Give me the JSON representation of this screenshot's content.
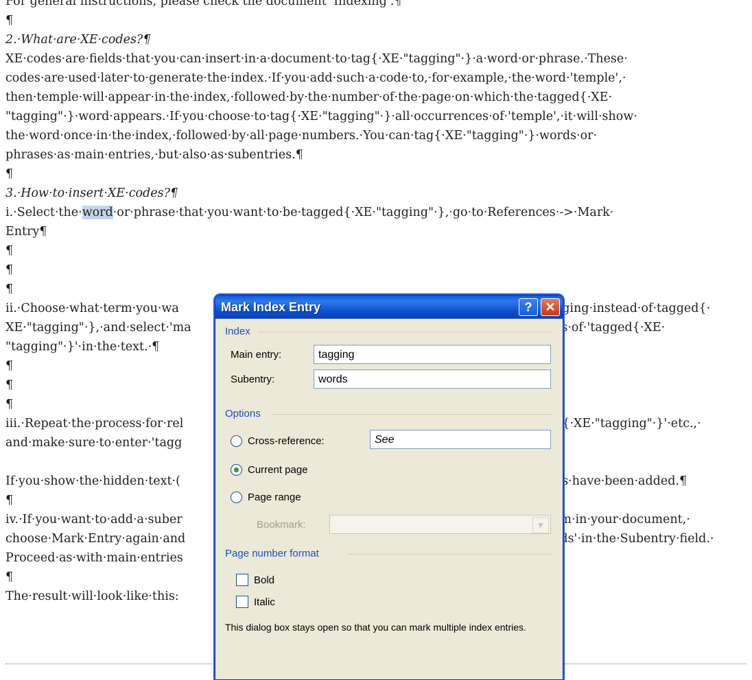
{
  "document": {
    "lines": [
      {
        "text": "For general instructions, please check the document 'Indexing'.¶",
        "style": "normal"
      },
      {
        "text": "¶",
        "style": "normal"
      },
      {
        "text": "2.·What·are·XE·codes?¶",
        "style": "italic"
      },
      {
        "text": "XE·codes·are·fields·that·you·can·insert·in·a·document·to·tag{·XE·\"tagging\"·}·a·word·or·phrase.·These·",
        "style": "normal"
      },
      {
        "text": "codes·are·used·later·to·generate·the·index.·If·you·add·such·a·code·to,·for·example,·the·word·'temple',·",
        "style": "normal"
      },
      {
        "text": "then·temple·will·appear·in·the·index,·followed·by·the·number·of·the·page·on·which·the·tagged{·XE·",
        "style": "normal"
      },
      {
        "text": "\"tagging\"·}·word·appears.·If·you·choose·to·tag{·XE·\"tagging\"·}·all·occurrences·of·'temple',·it·will·show·",
        "style": "normal"
      },
      {
        "text": "the·word·once·in·the·index,·followed·by·all·page·numbers.·You·can·tag{·XE·\"tagging\"·}·words·or·",
        "style": "normal"
      },
      {
        "text": "phrases·as·main·entries,·but·also·as·subentries.¶",
        "style": "normal"
      },
      {
        "text": "¶",
        "style": "normal"
      },
      {
        "text": "3.·How·to·insert·XE·codes?¶",
        "style": "italic"
      },
      {
        "text": "i.·Select·the·",
        "selected": "word",
        "rest": "·or·phrase·that·you·want·to·be·tagged{·XE·\"tagging\"·},·go·to·References·->·Mark·",
        "style": "select"
      },
      {
        "text": "Entry¶",
        "style": "normal"
      },
      {
        "text": "¶",
        "style": "normal"
      },
      {
        "text": "¶",
        "style": "normal"
      },
      {
        "text": "¶",
        "style": "normal"
      },
      {
        "text": "ii.·Choose·what·term·you·wa",
        "right": "gging·instead·of·tagged{·",
        "style": "split"
      },
      {
        "text": "XE·\"tagging\"·},·and·select·'ma",
        "right": "es·of·'tagged{·XE·",
        "style": "split"
      },
      {
        "text": "\"tagging\"·}'·in·the·text.·¶",
        "style": "normal"
      },
      {
        "text": "¶",
        "style": "normal"
      },
      {
        "text": "¶",
        "style": "normal"
      },
      {
        "text": "¶",
        "style": "normal"
      },
      {
        "text": "iii.·Repeat·the·process·for·rel",
        "right": "g{·XE·\"tagging\"·}'·etc.,·",
        "style": "split"
      },
      {
        "text": "and·make·sure·to·enter·'tagg",
        "style": "normal"
      },
      {
        "text": "",
        "style": "normal"
      },
      {
        "text": "If·you·show·the·hidden·text·(",
        "right": "ds·have·been·added.¶",
        "style": "split"
      },
      {
        "text": "¶",
        "style": "normal"
      },
      {
        "text": "iv.·If·you·want·to·add·a·suber",
        "right": "rm·in·your·document,·",
        "style": "split"
      },
      {
        "text": "choose·Mark·Entry·again·and",
        "right": "rds'·in·the·Subentry·field.·",
        "style": "split"
      },
      {
        "text": "Proceed·as·with·main·entries",
        "style": "normal"
      },
      {
        "text": "¶",
        "style": "normal"
      },
      {
        "text": "The·result·will·look·like·this:",
        "style": "normal"
      }
    ]
  },
  "dialog": {
    "title": "Mark Index Entry",
    "help_glyph": "?",
    "close_glyph": "✕",
    "index_group": "Index",
    "main_entry_label": "Main entry:",
    "main_entry_value": "tagging",
    "subentry_label": "Subentry:",
    "subentry_value": "words",
    "options_group": "Options",
    "cross_reference_label": "Cross-reference:",
    "cross_reference_value": "See",
    "current_page_label": "Current page",
    "page_range_label": "Page range",
    "bookmark_label": "Bookmark:",
    "page_number_format_group": "Page number format",
    "bold_label": "Bold",
    "italic_label": "Italic",
    "note": "This dialog box stays open so that you can mark multiple index entries.",
    "selected_option": "current_page"
  },
  "colors": {
    "titlebar": "#0a5bd7",
    "group_heading": "#1b4ec3",
    "selection": "#c2d6ec"
  }
}
